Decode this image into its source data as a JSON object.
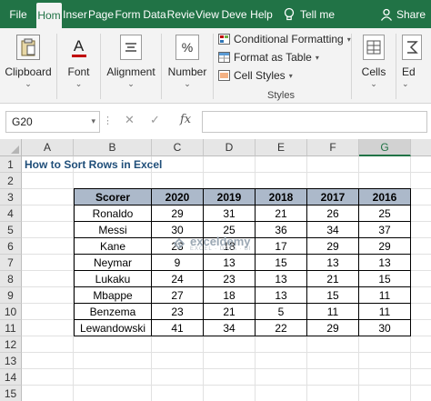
{
  "tabs": [
    "File",
    "Hom",
    "Inser",
    "Page",
    "Form",
    "Data",
    "Revie",
    "View",
    "Deve",
    "Help"
  ],
  "active_tab": "Hom",
  "tell_me": "Tell me",
  "share": "Share",
  "ribbon": {
    "clipboard": "Clipboard",
    "font": "Font",
    "alignment": "Alignment",
    "number": "Number",
    "number_icon": "%",
    "font_icon": "A",
    "conditional_formatting": "Conditional Formatting",
    "format_as_table": "Format as Table",
    "cell_styles": "Cell Styles",
    "styles_caption": "Styles",
    "cells": "Cells",
    "editing": "Ed"
  },
  "formula_bar": {
    "name_box": "G20",
    "cancel": "✕",
    "enter": "✓",
    "fx": "fx",
    "formula": ""
  },
  "grid": {
    "columns": [
      "A",
      "B",
      "C",
      "D",
      "E",
      "F",
      "G"
    ],
    "selected_column": "G",
    "rows": [
      "1",
      "2",
      "3",
      "4",
      "5",
      "6",
      "7",
      "8",
      "9",
      "10",
      "11",
      "12",
      "13",
      "14",
      "15"
    ],
    "title": "How to Sort Rows in Excel"
  },
  "table": {
    "headers": [
      "Scorer",
      "2020",
      "2019",
      "2018",
      "2017",
      "2016"
    ],
    "rows": [
      [
        "Ronaldo",
        "29",
        "31",
        "21",
        "26",
        "25"
      ],
      [
        "Messi",
        "30",
        "25",
        "36",
        "34",
        "37"
      ],
      [
        "Kane",
        "23",
        "18",
        "17",
        "29",
        "29"
      ],
      [
        "Neymar",
        "9",
        "13",
        "15",
        "13",
        "13"
      ],
      [
        "Lukaku",
        "24",
        "23",
        "13",
        "21",
        "15"
      ],
      [
        "Mbappe",
        "27",
        "18",
        "13",
        "15",
        "11"
      ],
      [
        "Benzema",
        "23",
        "21",
        "5",
        "11",
        "11"
      ],
      [
        "Lewandowski",
        "41",
        "34",
        "22",
        "29",
        "30"
      ]
    ]
  },
  "watermark": {
    "name": "exceldemy",
    "tagline": "EXCEL · DATA · BI"
  },
  "colors": {
    "excel_green": "#217346",
    "header_fill": "#acb9ca",
    "title_text": "#1f4e79"
  }
}
